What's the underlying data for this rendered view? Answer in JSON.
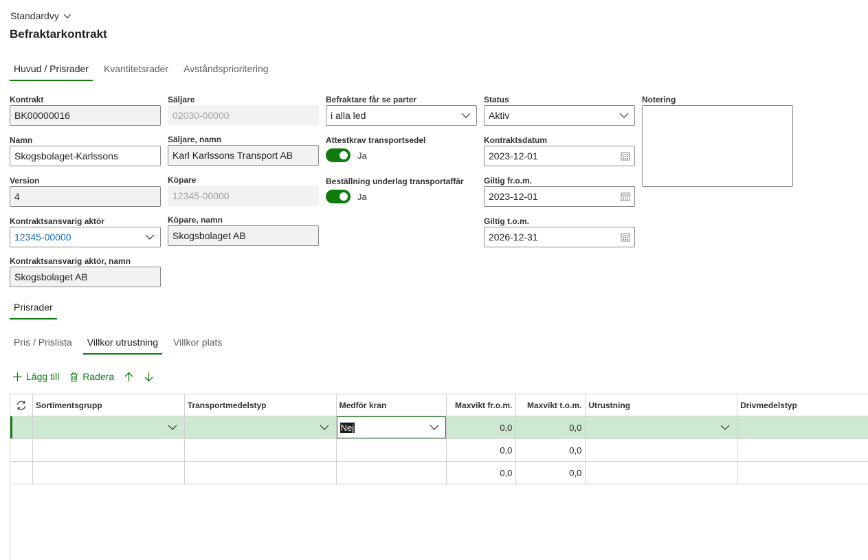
{
  "header": {
    "view_name": "Standardvy",
    "page_title": "Befraktarkontrakt"
  },
  "main_tabs": [
    {
      "label": "Huvud / Prisrader",
      "active": true
    },
    {
      "label": "Kvantitetsrader",
      "active": false
    },
    {
      "label": "Avståndsprioritering",
      "active": false
    }
  ],
  "form": {
    "kontrakt": {
      "label": "Kontrakt",
      "value": "BK00000016"
    },
    "namn": {
      "label": "Namn",
      "value": "Skogsbolaget-Karlssons"
    },
    "version": {
      "label": "Version",
      "value": "4"
    },
    "kontraktsansvarig": {
      "label": "Kontraktsansvarig aktör",
      "value": "12345-00000"
    },
    "kontraktsansvarig_namn": {
      "label": "Kontraktsansvarig aktör, namn",
      "value": "Skogsbolaget AB"
    },
    "saljare": {
      "label": "Säljare",
      "value": "02030-00000"
    },
    "saljare_namn": {
      "label": "Säljare, namn",
      "value": "Karl Karlssons Transport AB"
    },
    "kopare": {
      "label": "Köpare",
      "value": "12345-00000"
    },
    "kopare_namn": {
      "label": "Köpare, namn",
      "value": "Skogsbolaget AB"
    },
    "befraktare_parter": {
      "label": "Befraktare får se parter",
      "value": "i alla led"
    },
    "attestkrav": {
      "label": "Attestkrav transportsedel",
      "value": "Ja",
      "on": true
    },
    "bestallning": {
      "label": "Beställning underlag transportaffär",
      "value": "Ja",
      "on": true
    },
    "status": {
      "label": "Status",
      "value": "Aktiv"
    },
    "kontraktsdatum": {
      "label": "Kontraktsdatum",
      "value": "2023-12-01"
    },
    "giltig_from": {
      "label": "Giltig fr.o.m.",
      "value": "2023-12-01"
    },
    "giltig_tom": {
      "label": "Giltig t.o.m.",
      "value": "2026-12-31"
    },
    "notering": {
      "label": "Notering",
      "value": ""
    }
  },
  "section_tab": {
    "label": "Prisrader"
  },
  "sub_tabs": [
    {
      "label": "Pris / Prislista",
      "active": false
    },
    {
      "label": "Villkor utrustning",
      "active": true
    },
    {
      "label": "Villkor plats",
      "active": false
    }
  ],
  "toolbar": {
    "add_label": "Lägg till",
    "delete_label": "Radera"
  },
  "grid": {
    "columns": [
      "Sortimentsgrupp",
      "Transportmedelstyp",
      "Medför kran",
      "Maxvikt fr.o.m.",
      "Maxvikt t.o.m.",
      "Utrustning",
      "Drivmedelstyp"
    ],
    "rows": [
      {
        "sortimentsgrupp": "",
        "transportmedelstyp": "",
        "medfor_kran": "Nej",
        "maxvikt_from": "0,0",
        "maxvikt_tom": "0,0",
        "utrustning": "",
        "drivmedelstyp": ""
      },
      {
        "sortimentsgrupp": "",
        "transportmedelstyp": "",
        "medfor_kran": "",
        "maxvikt_from": "0,0",
        "maxvikt_tom": "0,0",
        "utrustning": "",
        "drivmedelstyp": ""
      },
      {
        "sortimentsgrupp": "",
        "transportmedelstyp": "",
        "medfor_kran": "",
        "maxvikt_from": "0,0",
        "maxvikt_tom": "0,0",
        "utrustning": "",
        "drivmedelstyp": ""
      }
    ]
  },
  "colors": {
    "accent": "#107c10",
    "selected_row": "#cfe8d1",
    "link": "#0f6cbd"
  },
  "icons": [
    "chevron-down-icon",
    "calendar-icon",
    "plus-icon",
    "trash-icon",
    "arrow-up-icon",
    "arrow-down-icon",
    "refresh-icon"
  ]
}
